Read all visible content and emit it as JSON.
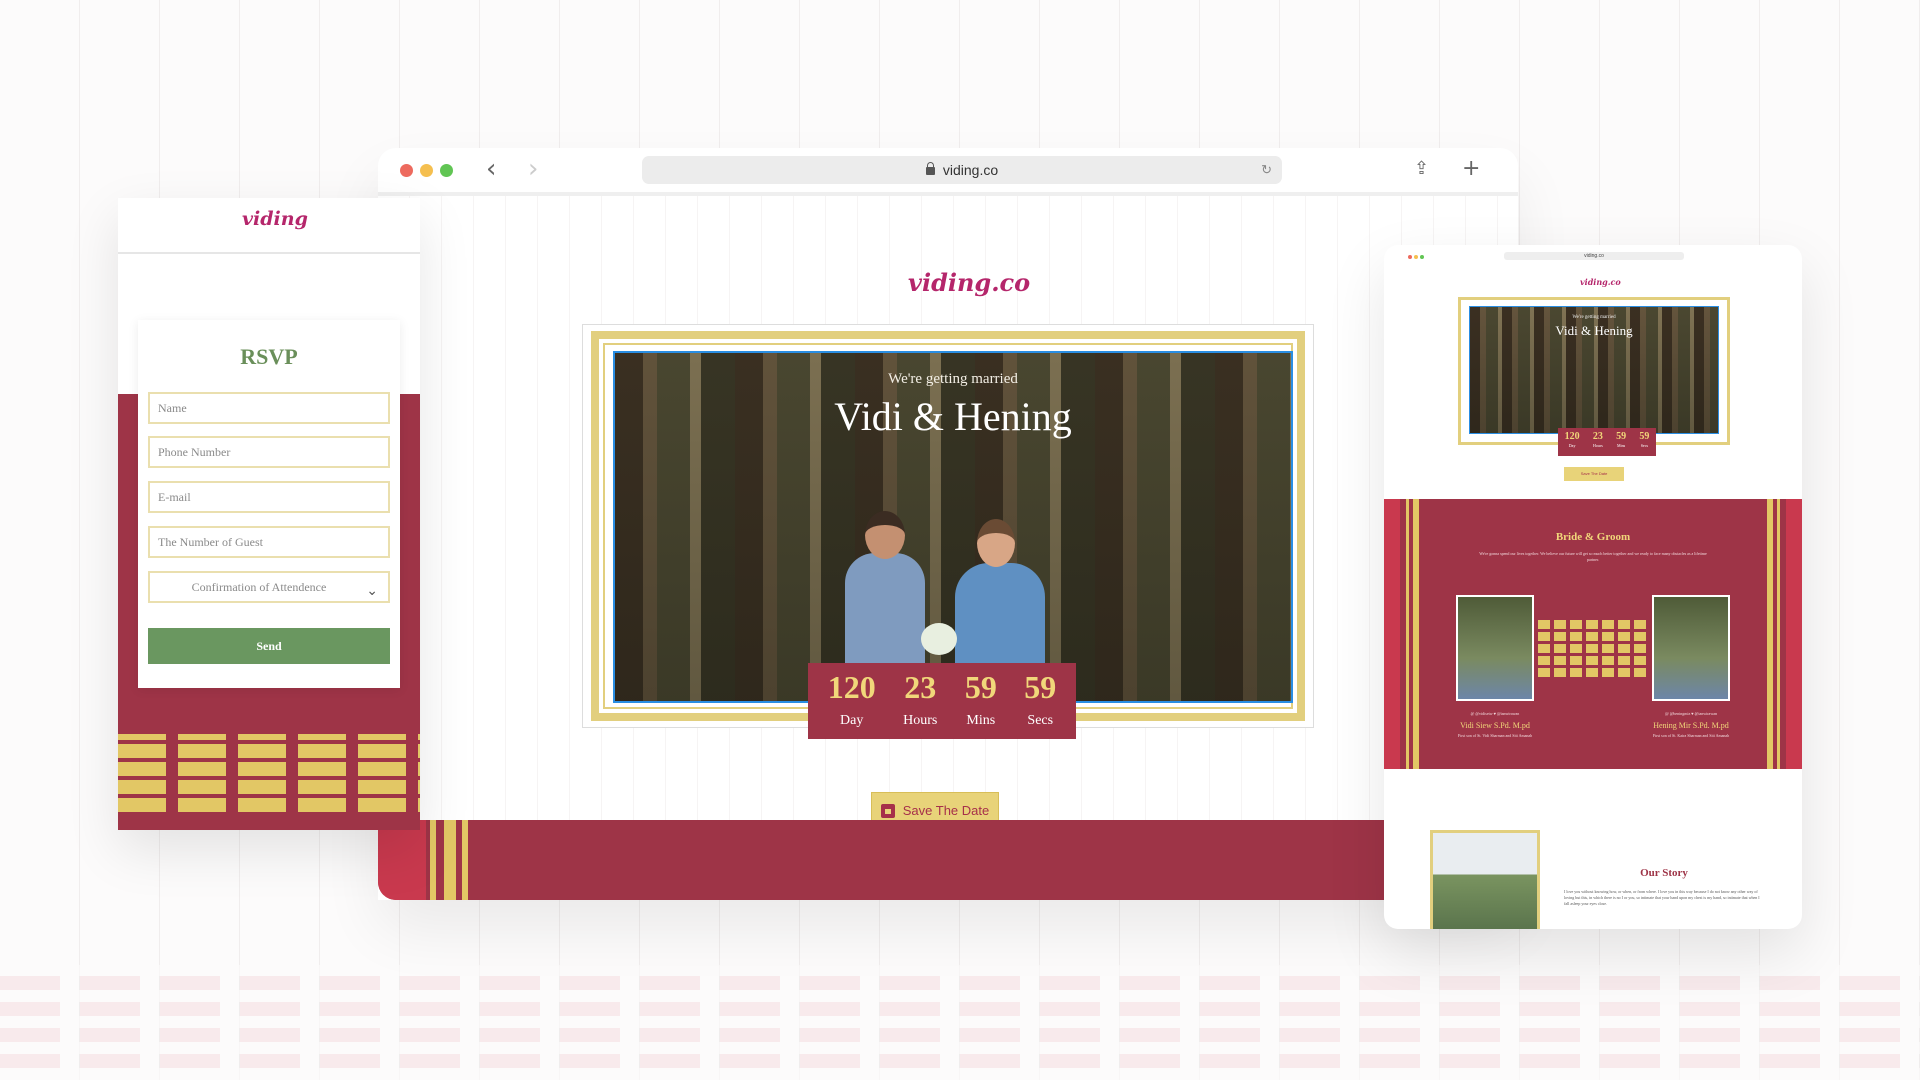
{
  "browser": {
    "url": "viding.co",
    "logo": "viding.co",
    "nav_back": "‹",
    "nav_forward": "›",
    "share_icon": "⇪",
    "add_tab_icon": "+",
    "reload_icon": "↻"
  },
  "hero": {
    "subtitle": "We're getting married",
    "title": "Vidi & Hening"
  },
  "countdown": [
    {
      "value": "120",
      "label": "Day"
    },
    {
      "value": "23",
      "label": "Hours"
    },
    {
      "value": "59",
      "label": "Mins"
    },
    {
      "value": "59",
      "label": "Secs"
    }
  ],
  "save_button": "Save The Date",
  "mobile": {
    "logo": "viding",
    "rsvp_title": "RSVP",
    "fields": [
      "Name",
      "Phone Number",
      "E-mail",
      "The Number of Guest"
    ],
    "select": "Confirmation of Attendence",
    "send": "Send"
  },
  "tablet": {
    "url": "viding.co",
    "logo": "viding.co",
    "subtitle": "We're getting married",
    "title": "Vidi & Hening",
    "save": "Save The Date",
    "bride_groom_title": "Bride & Groom",
    "bride_groom_text": "We're gonna spend our lives together. We believe our future will get so much better together and we ready to face many obstacles as a lifetime partner.",
    "groom_handle": "@ @vidisetw  ♥ @ianwirawan",
    "groom_name": "Vidi Siew S.Pd. M.pd",
    "groom_desc": "First son of St. Vidi Sharman and Siti Amanah",
    "bride_handle": "@ @heningmiz  ♥ @ianwirawan",
    "bride_name": "Hening Mir S.Pd. M.pd",
    "bride_desc": "First son of St. Kaira Sharman and Siti Amanah",
    "story_title": "Our Story",
    "story_text": "I love you without knowing how, or when, or from where. I love you in this way because I do not know any other way of loving but this, in which there is no I or you, so intimate that your hand upon my chest is my hand, so intimate that when I fall asleep your eyes close."
  },
  "colors": {
    "maroon": "#9e3447",
    "gold": "#e2c765",
    "green": "#6a9760",
    "logo_pink": "#b5266b"
  }
}
